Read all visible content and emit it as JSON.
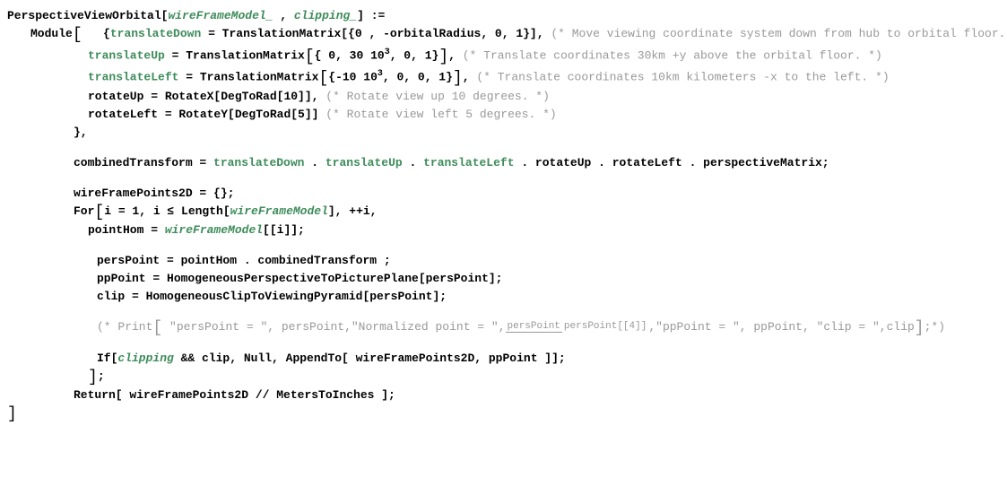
{
  "fn": {
    "name": "PerspectiveViewOrbital",
    "arg1": "wireFrameModel_",
    "arg2": "clipping_",
    "assign": ":="
  },
  "module": "Module",
  "translateDown": {
    "name": "translateDown",
    "eq": " = ",
    "call": "TranslationMatrix[{0 , -orbitalRadius,   0, 1}],",
    "comment": "(* Move viewing coordinate system down from hub to orbital floor. *)"
  },
  "translateUp": {
    "name": "translateUp",
    "eq": "   = ",
    "call_a": "TranslationMatrix",
    "vec_a": "{    0,  30 10",
    "vec_b": ", 0, 1}",
    "comma": ",",
    "comment": "(* Translate coordinates 30km +y above the orbital floor. *)"
  },
  "translateLeft": {
    "name": "translateLeft",
    "eq": " = ",
    "call_a": "TranslationMatrix",
    "vec_a": "{-10 10",
    "vec_b": ",    0,  0, 1}",
    "comma": ",",
    "comment": "(* Translate coordinates 10km kilometers -x to the left. *)"
  },
  "rotateUp": {
    "name": "rotateUp",
    "body": " = RotateX[DegToRad[10]],  ",
    "comment": "(* Rotate view up 10 degrees. *)"
  },
  "rotateLeft": {
    "name": "rotateLeft",
    "body": " = RotateY[DegToRad[5]]  ",
    "comment": "(* Rotate view left 5 degrees. *)"
  },
  "closeLocals": "},",
  "combined": {
    "name": "combinedTransform",
    "eq": " = ",
    "t1": "translateDown",
    "t2": "translateUp",
    "t3": "translateLeft",
    "t4": "rotateUp",
    "t5": "rotateLeft",
    "t6": "perspectiveMatrix",
    "dot": " . ",
    "semi": ";"
  },
  "wfInit": "wireFramePoints2D = {};",
  "for": {
    "head_a": "For",
    "head_b": "i = 1,  i ≤ Length[",
    "model": "wireFrameModel",
    "head_c": "],  ++i,"
  },
  "pointHom": {
    "a": "pointHom = ",
    "model": "wireFrameModel",
    "b": "[[i]];"
  },
  "persPoint": "persPoint = pointHom . combinedTransform ;",
  "ppPoint": "ppPoint = HomogeneousPerspectiveToPicturePlane[persPoint];",
  "clip": "clip = HomogeneousClipToViewingPyramid[persPoint];",
  "printComment": {
    "a": "(*  Print",
    "b": " \"persPoint = \", persPoint,\"Normalized point = \",",
    "frac_top": "persPoint",
    "frac_bot": "persPoint[[4]]",
    "c": ",\"ppPoint = \", ppPoint, \"clip = \",clip",
    "d": ";*)"
  },
  "ifLine": {
    "a": "If[",
    "clip": "clipping",
    "b": " && clip, Null, AppendTo[ wireFramePoints2D, ppPoint ]];"
  },
  "forClose": ";",
  "return": "Return[ wireFramePoints2D // MetersToInches ];",
  "finalClose": "]"
}
